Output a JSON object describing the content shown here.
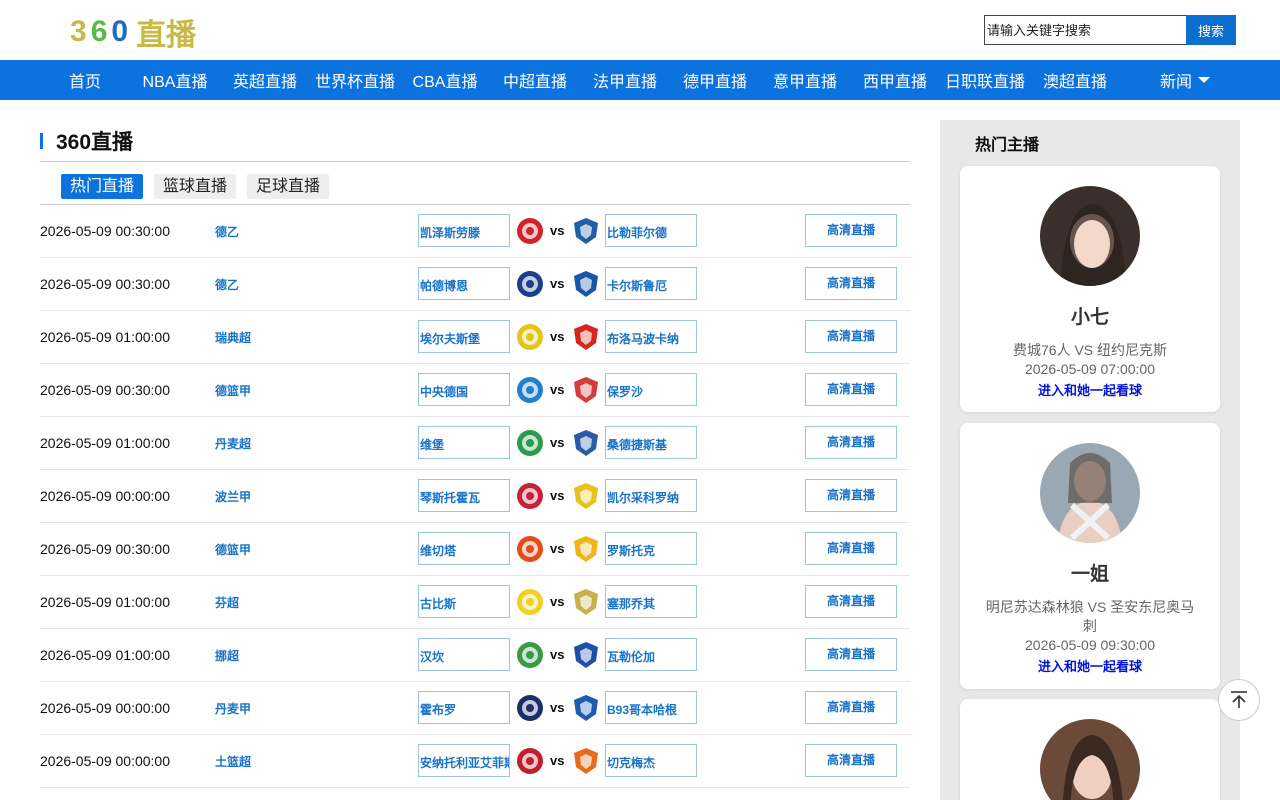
{
  "logo": {
    "d1": "3",
    "d2": "6",
    "d3": "0",
    "name": "直播"
  },
  "search": {
    "placeholder": "请输入关键字搜索",
    "button": "搜索"
  },
  "nav": [
    "首页",
    "NBA直播",
    "英超直播",
    "世界杯直播",
    "CBA直播",
    "中超直播",
    "法甲直播",
    "德甲直播",
    "意甲直播",
    "西甲直播",
    "日职联直播",
    "澳超直播"
  ],
  "nav_more": "新闻",
  "section": {
    "title": "360直播",
    "tabs": [
      "热门直播",
      "篮球直播",
      "足球直播"
    ]
  },
  "watch_label": "高清直播",
  "vs_label": "vs",
  "matches": [
    {
      "time": "2026-05-09 00:30:00",
      "league": "德乙",
      "home": "凯泽斯劳滕",
      "away": "比勒菲尔德",
      "home_color": "#d2232a",
      "away_color": "#1f5fa8"
    },
    {
      "time": "2026-05-09 00:30:00",
      "league": "德乙",
      "home": "帕德博恩",
      "away": "卡尔斯鲁厄",
      "home_color": "#1b3f8b",
      "away_color": "#1a56a6"
    },
    {
      "time": "2026-05-09 01:00:00",
      "league": "瑞典超",
      "home": "埃尔夫斯堡",
      "away": "布洛马波卡纳",
      "home_color": "#e5c41a",
      "away_color": "#d7261e"
    },
    {
      "time": "2026-05-09 00:30:00",
      "league": "德篮甲",
      "home": "中央德国",
      "away": "保罗沙",
      "home_color": "#1f7fd1",
      "away_color": "#d63b3b"
    },
    {
      "time": "2026-05-09 01:00:00",
      "league": "丹麦超",
      "home": "维堡",
      "away": "桑德捷斯基",
      "home_color": "#2a9a4d",
      "away_color": "#2b5aa6"
    },
    {
      "time": "2026-05-09 00:00:00",
      "league": "波兰甲",
      "home": "琴斯托霍瓦",
      "away": "凯尔采科罗纳",
      "home_color": "#c5223a",
      "away_color": "#e7c21c"
    },
    {
      "time": "2026-05-09 00:30:00",
      "league": "德篮甲",
      "home": "维切塔",
      "away": "罗斯托克",
      "home_color": "#e24c1d",
      "away_color": "#f2b41c"
    },
    {
      "time": "2026-05-09 01:00:00",
      "league": "芬超",
      "home": "古比斯",
      "away": "塞那乔其",
      "home_color": "#f0d020",
      "away_color": "#c7b14a"
    },
    {
      "time": "2026-05-09 01:00:00",
      "league": "挪超",
      "home": "汉坎",
      "away": "瓦勒伦加",
      "home_color": "#3a9a4a",
      "away_color": "#1f4fa6"
    },
    {
      "time": "2026-05-09 00:00:00",
      "league": "丹麦甲",
      "home": "霍布罗",
      "away": "B93哥本哈根",
      "home_color": "#1b2f6b",
      "away_color": "#1e5bb0"
    },
    {
      "time": "2026-05-09 00:00:00",
      "league": "土篮超",
      "home": "安纳托利亚艾菲斯",
      "away": "切克梅杰",
      "home_color": "#c21f2e",
      "away_color": "#e86a1f"
    }
  ],
  "sidebar": {
    "title": "热门主播",
    "anchors": [
      {
        "name": "小七",
        "match": "费城76人 VS 纽约尼克斯",
        "time": "2026-05-09 07:00:00",
        "link": "进入和她一起看球",
        "tone": "#3b2f2b"
      },
      {
        "name": "一姐",
        "match": "明尼苏达森林狼 VS 圣安东尼奥马刺",
        "time": "2026-05-09 09:30:00",
        "link": "进入和她一起看球",
        "tone": "#8a9aa8"
      },
      {
        "name": "",
        "match": "",
        "time": "",
        "link": "",
        "tone": "#6b4a3a"
      }
    ]
  }
}
